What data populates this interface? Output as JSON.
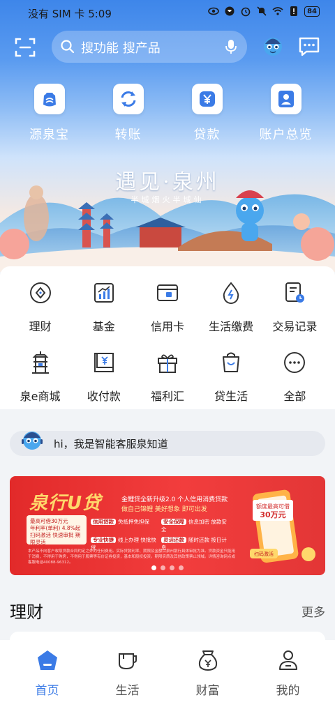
{
  "status_bar": {
    "carrier_time": "没有 SIM 卡 5:09",
    "battery": "84"
  },
  "search": {
    "placeholder": "搜功能 搜产品"
  },
  "quick_actions": [
    {
      "label": "源泉宝",
      "icon": "wallet-icon"
    },
    {
      "label": "转账",
      "icon": "transfer-icon"
    },
    {
      "label": "贷款",
      "icon": "yuan-icon"
    },
    {
      "label": "账户总览",
      "icon": "account-icon"
    }
  ],
  "hero_banner": {
    "title": "遇见·泉州",
    "subtitle": "半城烟火半城仙"
  },
  "services_row1": [
    {
      "label": "理财",
      "icon": "wealth-icon"
    },
    {
      "label": "基金",
      "icon": "fund-chart-icon"
    },
    {
      "label": "信用卡",
      "icon": "credit-card-icon"
    },
    {
      "label": "生活缴费",
      "icon": "water-drop-icon"
    },
    {
      "label": "交易记录",
      "icon": "transaction-record-icon"
    }
  ],
  "services_row2": [
    {
      "label": "泉e商城",
      "icon": "pagoda-icon"
    },
    {
      "label": "收付款",
      "icon": "payment-icon"
    },
    {
      "label": "福利汇",
      "icon": "gift-icon"
    },
    {
      "label": "贷生活",
      "icon": "shopping-bag-icon"
    },
    {
      "label": "全部",
      "icon": "more-dots-icon"
    }
  ],
  "assistant": {
    "text": "hi，我是智能客服泉知道"
  },
  "promo": {
    "title": "泉行U贷",
    "subtitle1": "金鲤贷全新升级2.0  个人信用消费贷款",
    "subtitle2": "做自己锦鲤  美好想象 即可出发",
    "card_line1": "最高可借30万元",
    "card_line2": "年利率(单利) 4.8%起",
    "card_line3": "扫码激活 快速审批 期限灵活",
    "tags": [
      {
        "tag": "信用贷款",
        "text": "免抵押免担保"
      },
      {
        "tag": "安全保障",
        "text": "信息加密 放款安全"
      },
      {
        "tag": "专业快捷",
        "text": "线上办理 快批快贷"
      },
      {
        "tag": "灵活还款",
        "text": "随时还款 按日计息"
      }
    ],
    "fine_print": "本产品不向客户收取贷款合同约定之外的任何费用。实际贷款利率、期限及金额以泉州银行具体审批为准。贷款资金只能用于消费，不得用于购房，不得用于股票等有价证券投资，基本和股权投资。期限实质及其他政策禁止领域。详情咨询网点或客服电话40088-96312。",
    "badge_line1": "额度最高可借",
    "badge_line2": "30万元",
    "scan_label": "扫码激活"
  },
  "section": {
    "title": "理财",
    "more": "更多"
  },
  "tabbar": [
    {
      "label": "首页",
      "icon": "home-icon",
      "active": true
    },
    {
      "label": "生活",
      "icon": "cup-icon",
      "active": false
    },
    {
      "label": "财富",
      "icon": "money-bag-icon",
      "active": false
    },
    {
      "label": "我的",
      "icon": "profile-icon",
      "active": false
    }
  ],
  "colors": {
    "brand_blue": "#3b7be6",
    "promo_red": "#e22a2a",
    "promo_gold": "#ffd86b"
  }
}
